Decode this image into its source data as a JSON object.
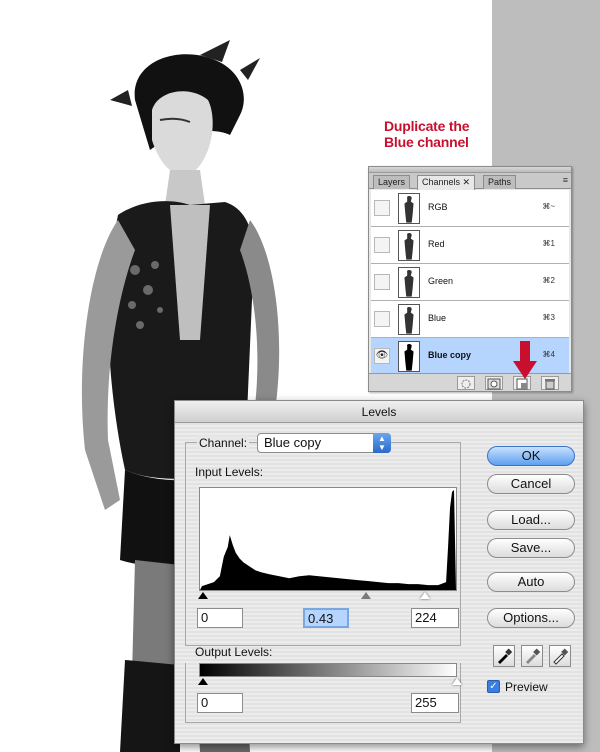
{
  "annotation": {
    "line1": "Duplicate the",
    "line2": "Blue channel"
  },
  "channels_panel": {
    "tabs": [
      {
        "label": "Layers"
      },
      {
        "label": "Channels ✕"
      },
      {
        "label": "Paths"
      }
    ],
    "menu_glyph": "≡",
    "rows": [
      {
        "name": "RGB",
        "shortcut": "⌘~",
        "visible": false,
        "selected": false
      },
      {
        "name": "Red",
        "shortcut": "⌘1",
        "visible": false,
        "selected": false
      },
      {
        "name": "Green",
        "shortcut": "⌘2",
        "visible": false,
        "selected": false
      },
      {
        "name": "Blue",
        "shortcut": "⌘3",
        "visible": false,
        "selected": false
      },
      {
        "name": "Blue copy",
        "shortcut": "⌘4",
        "visible": true,
        "selected": true
      }
    ],
    "eye_glyph": "👁"
  },
  "levels": {
    "title": "Levels",
    "channel_label": "Channel:",
    "channel_value": "Blue copy",
    "input_levels_label": "Input Levels:",
    "input_black": "0",
    "input_gamma": "0.43",
    "input_white": "224",
    "output_levels_label": "Output Levels:",
    "output_black": "0",
    "output_white": "255",
    "buttons": {
      "ok": "OK",
      "cancel": "Cancel",
      "load": "Load...",
      "save": "Save...",
      "auto": "Auto",
      "options": "Options..."
    },
    "preview_label": "Preview",
    "preview_checked": true,
    "check_glyph": "✓"
  },
  "colors": {
    "annotation_red": "#c8102e",
    "selection_blue": "#b5d5ff",
    "arrow_red": "#c8102e"
  }
}
